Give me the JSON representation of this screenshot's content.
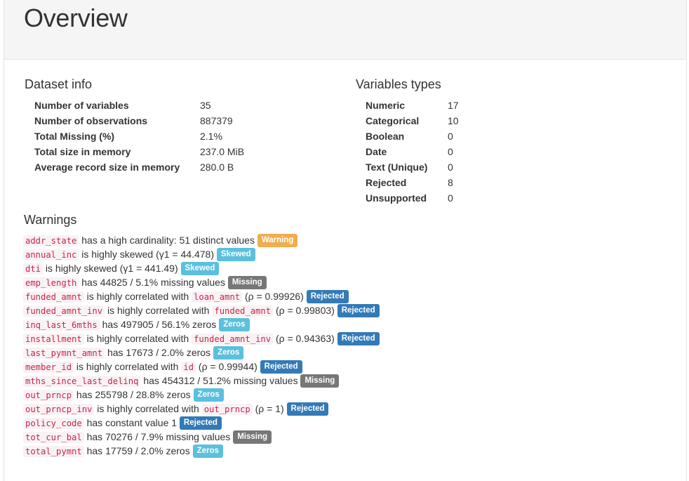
{
  "header": {
    "title": "Overview"
  },
  "dataset_info": {
    "title": "Dataset info",
    "rows": [
      {
        "key": "Number of variables",
        "value": "35"
      },
      {
        "key": "Number of observations",
        "value": "887379"
      },
      {
        "key": "Total Missing (%)",
        "value": "2.1%"
      },
      {
        "key": "Total size in memory",
        "value": "237.0 MiB"
      },
      {
        "key": "Average record size in memory",
        "value": "280.0 B"
      }
    ]
  },
  "variable_types": {
    "title": "Variables types",
    "rows": [
      {
        "key": "Numeric",
        "value": "17"
      },
      {
        "key": "Categorical",
        "value": "10"
      },
      {
        "key": "Boolean",
        "value": "0"
      },
      {
        "key": "Date",
        "value": "0"
      },
      {
        "key": "Text (Unique)",
        "value": "0"
      },
      {
        "key": "Rejected",
        "value": "8"
      },
      {
        "key": "Unsupported",
        "value": "0"
      }
    ]
  },
  "warnings": {
    "title": "Warnings",
    "items": [
      {
        "var": "addr_state",
        "pre": " has a high cardinality: 51 distinct values ",
        "label": "Warning"
      },
      {
        "var": "annual_inc",
        "pre": " is highly skewed (γ1 = 44.478) ",
        "label": "Skewed"
      },
      {
        "var": "dti",
        "pre": " is highly skewed (γ1 = 441.49) ",
        "label": "Skewed"
      },
      {
        "var": "emp_length",
        "pre": " has 44825 / 5.1% missing values ",
        "label": "Missing"
      },
      {
        "var": "funded_amnt",
        "pre": " is highly correlated with ",
        "var2": "loan_amnt",
        "post": " (ρ = 0.99926) ",
        "label": "Rejected"
      },
      {
        "var": "funded_amnt_inv",
        "pre": " is highly correlated with ",
        "var2": "funded_amnt",
        "post": " (ρ = 0.99803) ",
        "label": "Rejected"
      },
      {
        "var": "inq_last_6mths",
        "pre": " has 497905 / 56.1% zeros ",
        "label": "Zeros"
      },
      {
        "var": "installment",
        "pre": " is highly correlated with ",
        "var2": "funded_amnt_inv",
        "post": " (ρ = 0.94363) ",
        "label": "Rejected"
      },
      {
        "var": "last_pymnt_amnt",
        "pre": " has 17673 / 2.0% zeros ",
        "label": "Zeros"
      },
      {
        "var": "member_id",
        "pre": " is highly correlated with ",
        "var2": "id",
        "post": " (ρ = 0.99944) ",
        "label": "Rejected"
      },
      {
        "var": "mths_since_last_delinq",
        "pre": " has 454312 / 51.2% missing values ",
        "label": "Missing"
      },
      {
        "var": "out_prncp",
        "pre": " has 255798 / 28.8% zeros ",
        "label": "Zeros"
      },
      {
        "var": "out_prncp_inv",
        "pre": " is highly correlated with ",
        "var2": "out_prncp",
        "post": " (ρ = 1) ",
        "label": "Rejected"
      },
      {
        "var": "policy_code",
        "pre": " has constant value 1 ",
        "label": "Rejected"
      },
      {
        "var": "tot_cur_bal",
        "pre": " has 70276 / 7.9% missing values ",
        "label": "Missing"
      },
      {
        "var": "total_pymnt",
        "pre": " has 17759 / 2.0% zeros ",
        "label": "Zeros"
      }
    ]
  },
  "colors": {
    "warning": "#f0ad4e",
    "skewed": "#5bc0de",
    "missing": "#777777",
    "rejected": "#337ab7",
    "zeros": "#5bc0de",
    "code_text": "#c7254e",
    "code_bg": "#f9f2f4"
  }
}
